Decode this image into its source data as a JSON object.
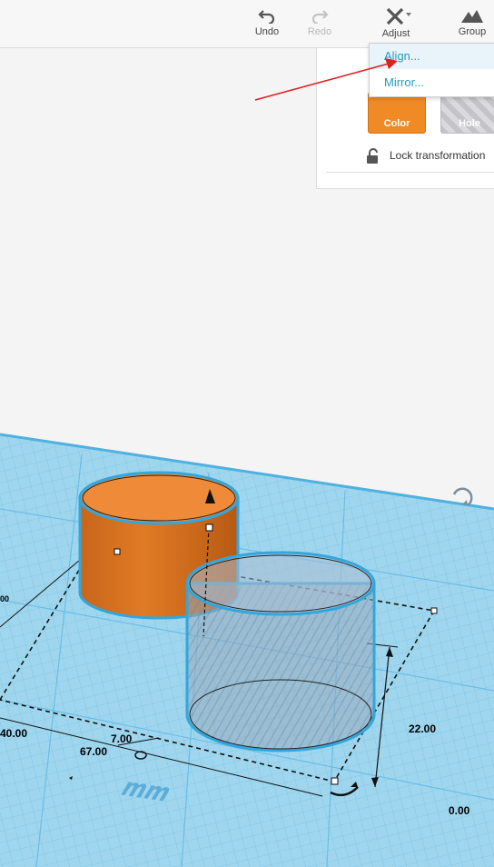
{
  "toolbar": {
    "undo_label": "Undo",
    "redo_label": "Redo",
    "adjust_label": "Adjust",
    "group_label": "Group"
  },
  "adjust_menu": {
    "items": [
      {
        "label": "Align..."
      },
      {
        "label": "Mirror..."
      }
    ]
  },
  "inspector": {
    "color_label": "Color",
    "hole_label": "Hole",
    "lock_label": "Lock transformation",
    "color_value": "#f08a24"
  },
  "dimensions": {
    "length": "67.00",
    "width_partial": "40.00",
    "spacing": "7.00",
    "height": "22.00",
    "elevation": "0.00",
    "left_cut": "00"
  },
  "workplane": {
    "unit_label": "mm"
  }
}
